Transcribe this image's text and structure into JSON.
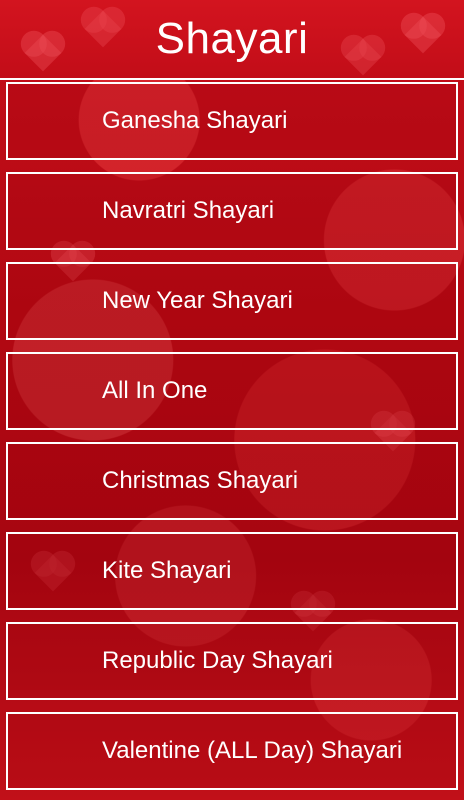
{
  "app": {
    "title": "Shayari"
  },
  "menu": {
    "items": [
      {
        "label": "Ganesha Shayari"
      },
      {
        "label": "Navratri Shayari"
      },
      {
        "label": "New Year Shayari"
      },
      {
        "label": "All In One"
      },
      {
        "label": "Christmas Shayari"
      },
      {
        "label": "Kite Shayari"
      },
      {
        "label": "Republic Day Shayari"
      },
      {
        "label": "Valentine (ALL Day) Shayari"
      }
    ]
  },
  "colors": {
    "background": "#b20812",
    "header": "#d3141f",
    "border": "#ffffff",
    "text": "#ffffff"
  }
}
